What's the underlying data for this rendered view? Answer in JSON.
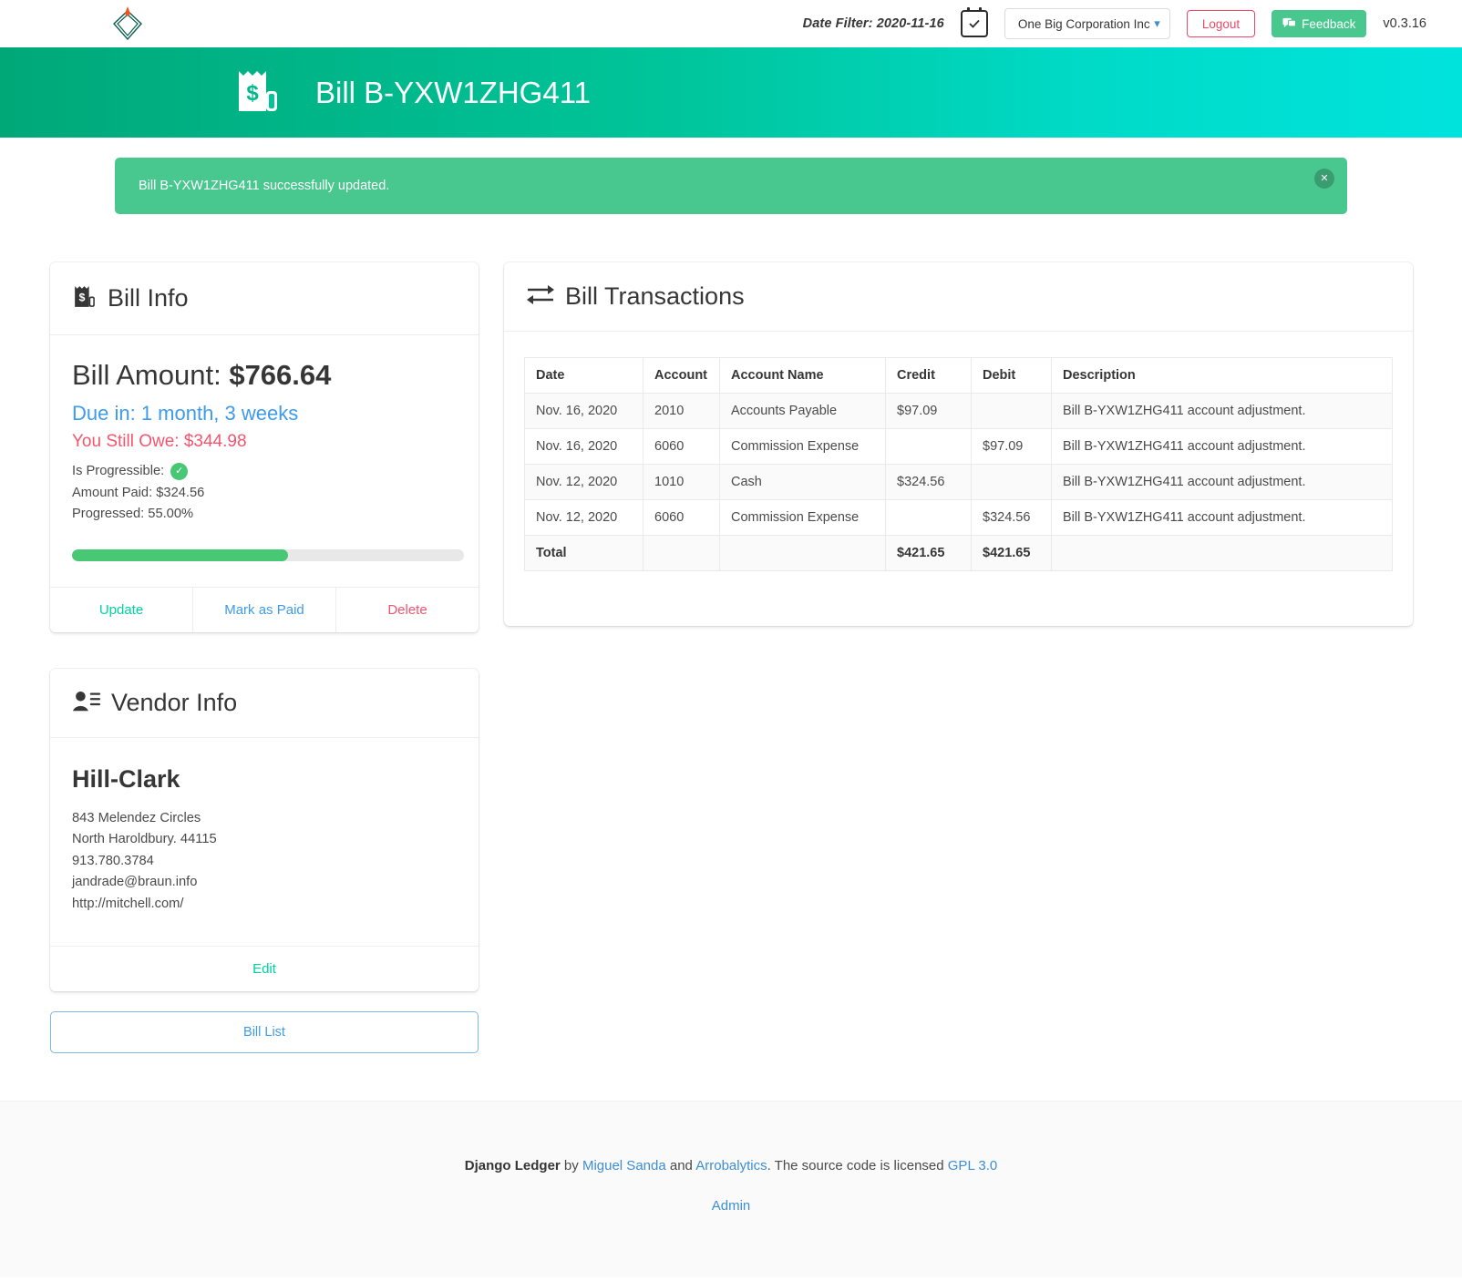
{
  "topbar": {
    "logo_icon": "diamond-rocket-logo-icon",
    "date_filter_label": "Date Filter: 2020-11-16",
    "calendar_icon": "calendar-check-icon",
    "entity_selected": "One Big Corporation Inc",
    "entity_chevron_icon": "chevron-down-icon",
    "logout_label": "Logout",
    "feedback_label": "Feedback",
    "feedback_icon": "comment-icon",
    "version": "v0.3.16"
  },
  "hero": {
    "icon": "receipt-dollar-icon",
    "title": "Bill B-YXW1ZHG411"
  },
  "alert": {
    "message": "Bill B-YXW1ZHG411 successfully updated.",
    "close_icon": "close-icon",
    "color": "#48c78e"
  },
  "bill_info": {
    "icon": "receipt-dollar-icon",
    "heading": "Bill Info",
    "amount_label": "Bill Amount:",
    "amount_value": "$766.64",
    "due_in": "Due in: 1 month, 3 weeks",
    "still_owe": "You Still Owe: $344.98",
    "is_progressible_label": "Is Progressible:",
    "is_progressible_icon": "check-circle-icon",
    "amount_paid": "Amount Paid: $324.56",
    "progressed": "Progressed: 55.00%",
    "progress_percent": 55,
    "actions": {
      "update": "Update",
      "mark_as_paid": "Mark as Paid",
      "delete": "Delete"
    },
    "colors": {
      "update": "#00d1a0",
      "mark_as_paid": "#3e9bea",
      "delete": "#f4556e",
      "due": "#3e9bea",
      "owe": "#f4556e",
      "progress": "#48c774"
    }
  },
  "vendor_info": {
    "icon": "contact-list-icon",
    "heading": "Vendor Info",
    "name": "Hill-Clark",
    "address_1": "843 Melendez Circles",
    "address_2": "North Haroldbury. 44115",
    "phone": "913.780.3784",
    "email": "jandrade@braun.info",
    "website": "http://mitchell.com/",
    "edit_label": "Edit"
  },
  "bill_list_button": "Bill List",
  "transactions": {
    "icon": "exchange-arrows-icon",
    "heading": "Bill Transactions",
    "columns": [
      "Date",
      "Account",
      "Account Name",
      "Credit",
      "Debit",
      "Description"
    ],
    "rows": [
      {
        "date": "Nov. 16, 2020",
        "account": "2010",
        "account_name": "Accounts Payable",
        "credit": "$97.09",
        "debit": "",
        "description": "Bill B-YXW1ZHG411 account adjustment."
      },
      {
        "date": "Nov. 16, 2020",
        "account": "6060",
        "account_name": "Commission Expense",
        "credit": "",
        "debit": "$97.09",
        "description": "Bill B-YXW1ZHG411 account adjustment."
      },
      {
        "date": "Nov. 12, 2020",
        "account": "1010",
        "account_name": "Cash",
        "credit": "$324.56",
        "debit": "",
        "description": "Bill B-YXW1ZHG411 account adjustment."
      },
      {
        "date": "Nov. 12, 2020",
        "account": "6060",
        "account_name": "Commission Expense",
        "credit": "",
        "debit": "$324.56",
        "description": "Bill B-YXW1ZHG411 account adjustment."
      }
    ],
    "total": {
      "label": "Total",
      "account": "",
      "account_name": "",
      "credit": "$421.65",
      "debit": "$421.65",
      "description": ""
    }
  },
  "footer": {
    "app_name": "Django Ledger",
    "by": " by ",
    "author": "Miguel Sanda",
    "and": " and ",
    "company": "Arrobalytics",
    "license_text": ". The source code is licensed ",
    "license": "GPL 3.0",
    "admin": "Admin"
  }
}
